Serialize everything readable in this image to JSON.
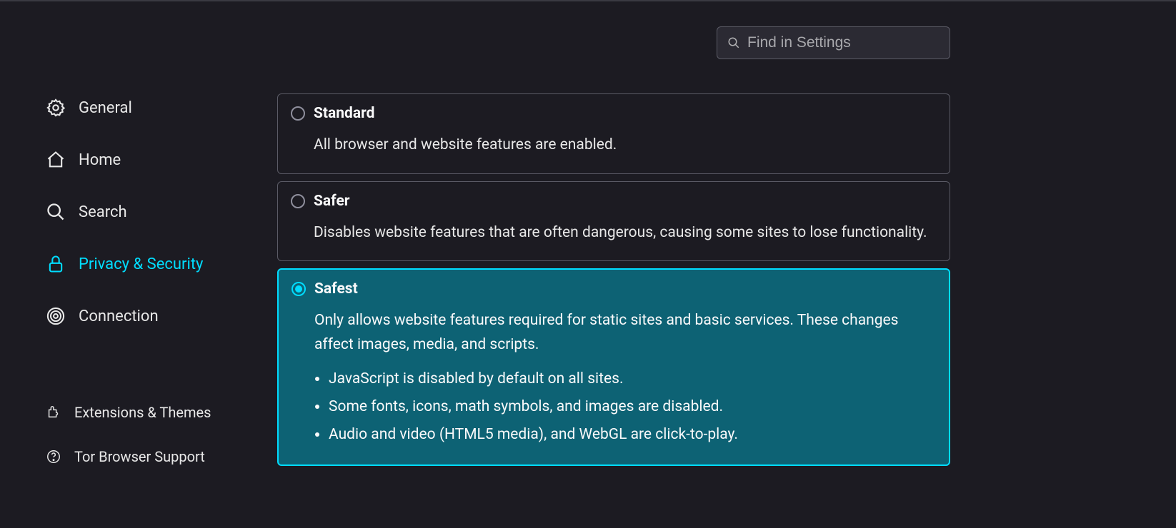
{
  "search": {
    "placeholder": "Find in Settings"
  },
  "sidebar": {
    "items": [
      {
        "label": "General"
      },
      {
        "label": "Home"
      },
      {
        "label": "Search"
      },
      {
        "label": "Privacy & Security"
      },
      {
        "label": "Connection"
      }
    ],
    "bottom": [
      {
        "label": "Extensions & Themes"
      },
      {
        "label": "Tor Browser Support"
      }
    ]
  },
  "security": {
    "standard": {
      "title": "Standard",
      "desc": "All browser and website features are enabled."
    },
    "safer": {
      "title": "Safer",
      "desc": "Disables website features that are often dangerous, causing some sites to lose functionality."
    },
    "safest": {
      "title": "Safest",
      "desc": "Only allows website features required for static sites and basic services. These changes affect images, media, and scripts.",
      "bullets": [
        "JavaScript is disabled by default on all sites.",
        "Some fonts, icons, math symbols, and images are disabled.",
        "Audio and video (HTML5 media), and WebGL are click-to-play."
      ]
    }
  }
}
